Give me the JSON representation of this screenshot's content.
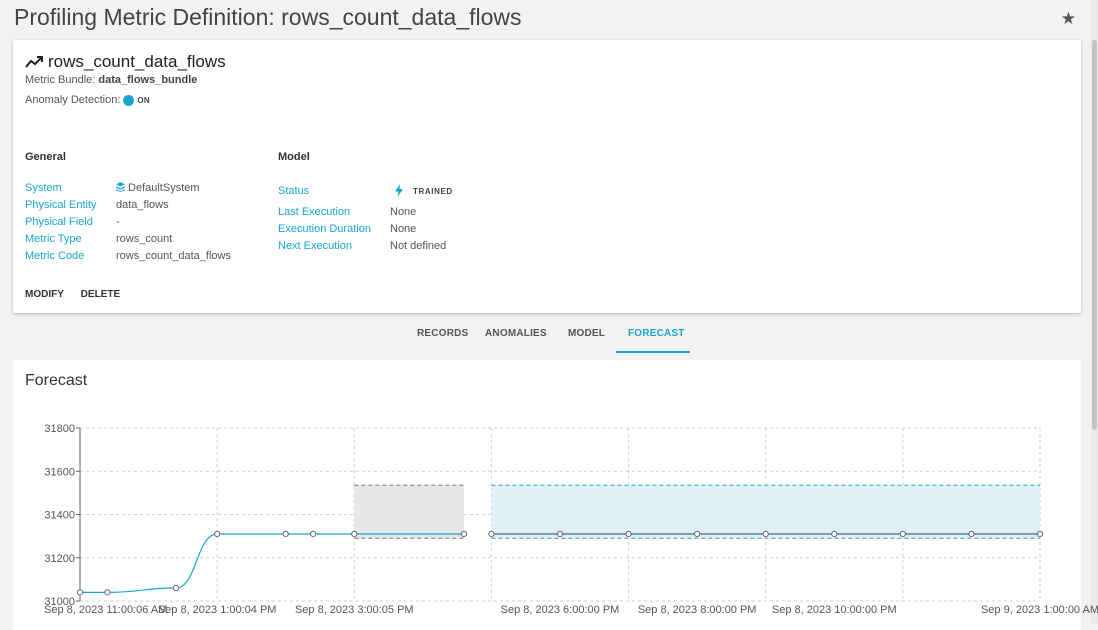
{
  "page": {
    "title": "Profiling Metric Definition: rows_count_data_flows"
  },
  "header": {
    "star_icon": "star-icon"
  },
  "metric": {
    "name": "rows_count_data_flows",
    "bundle_label": "Metric Bundle:",
    "bundle_value": "data_flows_bundle",
    "anomaly_label": "Anomaly Detection:",
    "anomaly_state": "ON"
  },
  "general": {
    "title": "General",
    "rows": [
      {
        "label": "System",
        "value": "DefaultSystem"
      },
      {
        "label": "Physical Entity",
        "value": "data_flows"
      },
      {
        "label": "Physical Field",
        "value": "-"
      },
      {
        "label": "Metric Type",
        "value": "rows_count"
      },
      {
        "label": "Metric Code",
        "value": "rows_count_data_flows"
      }
    ]
  },
  "model": {
    "title": "Model",
    "rows": [
      {
        "label": "Status",
        "value": "TRAINED"
      },
      {
        "label": "Last Execution",
        "value": "None"
      },
      {
        "label": "Execution Duration",
        "value": "None"
      },
      {
        "label": "Next Execution",
        "value": "Not defined"
      }
    ]
  },
  "actions": {
    "modify": "MODIFY",
    "delete": "DELETE"
  },
  "tabs": [
    {
      "label": "RECORDS",
      "active": false
    },
    {
      "label": "ANOMALIES",
      "active": false
    },
    {
      "label": "MODEL",
      "active": false
    },
    {
      "label": "FORECAST",
      "active": true
    }
  ],
  "forecast": {
    "title": "Forecast"
  },
  "colors": {
    "accent": "#1aa5cc",
    "band_fill": "#dff1f7",
    "gray_band": "#e6e7e9"
  },
  "chart_data": {
    "type": "line",
    "title": "Forecast",
    "xlabel": "",
    "ylabel": "",
    "ylim": [
      31000,
      31800
    ],
    "yticks": [
      31000,
      31200,
      31400,
      31600,
      31800
    ],
    "xticks": [
      {
        "label": "Sep 8, 2023 11:00:06 AM",
        "t": 0
      },
      {
        "label": "Sep 8, 2023 1:00:04 PM",
        "t": 2
      },
      {
        "label": "Sep 8, 2023 3:00:05 PM",
        "t": 4
      },
      {
        "label": "Sep 8, 2023 6:00:00 PM",
        "t": 7
      },
      {
        "label": "Sep 8, 2023 8:00:00 PM",
        "t": 9
      },
      {
        "label": "Sep 8, 2023 10:00:00 PM",
        "t": 11
      },
      {
        "label": "Sep 9, 2023 1:00:00 AM",
        "t": 14
      }
    ],
    "gridlines_t": [
      0,
      2,
      4,
      6,
      8,
      10,
      12,
      14
    ],
    "series": [
      {
        "points": [
          [
            0,
            31040
          ],
          [
            0.4,
            31040
          ],
          [
            1.4,
            31060
          ],
          [
            2,
            31310
          ],
          [
            3,
            31310
          ],
          [
            3.4,
            31310
          ],
          [
            4,
            31310
          ],
          [
            5.6,
            31310
          ]
        ]
      },
      {
        "points": [
          [
            6,
            31310
          ],
          [
            7,
            31310
          ],
          [
            8,
            31310
          ],
          [
            9,
            31310
          ],
          [
            10,
            31310
          ],
          [
            11,
            31310
          ],
          [
            12,
            31310
          ],
          [
            13,
            31310
          ],
          [
            14,
            31310
          ]
        ],
        "band_upper": 31535,
        "band_lower": 31290
      }
    ],
    "gray_band": {
      "t_start": 4,
      "t_end": 5.6,
      "upper": 31535,
      "lower": 31290
    },
    "grid": true
  }
}
